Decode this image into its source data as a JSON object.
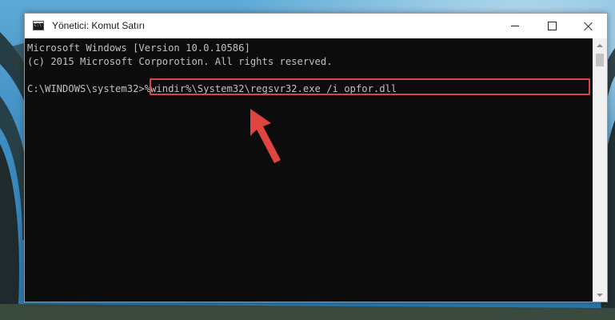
{
  "window": {
    "title": "Yönetici: Komut Satırı",
    "minimize_icon": "minimize-icon",
    "maximize_icon": "maximize-icon",
    "close_icon": "close-icon"
  },
  "console": {
    "lines": [
      "Microsoft Windows [Version 10.0.10586]",
      "(c) 2015 Microsoft Corporotion. All rights reserved."
    ],
    "prompt": "C:\\WINDOWS\\system32>",
    "command": "%windir%\\System32\\regsvr32.exe /i opfor.dll"
  },
  "colors": {
    "console_bg": "#0c0c0c",
    "console_text": "#c0c0c0",
    "highlight": "#d9434a"
  }
}
